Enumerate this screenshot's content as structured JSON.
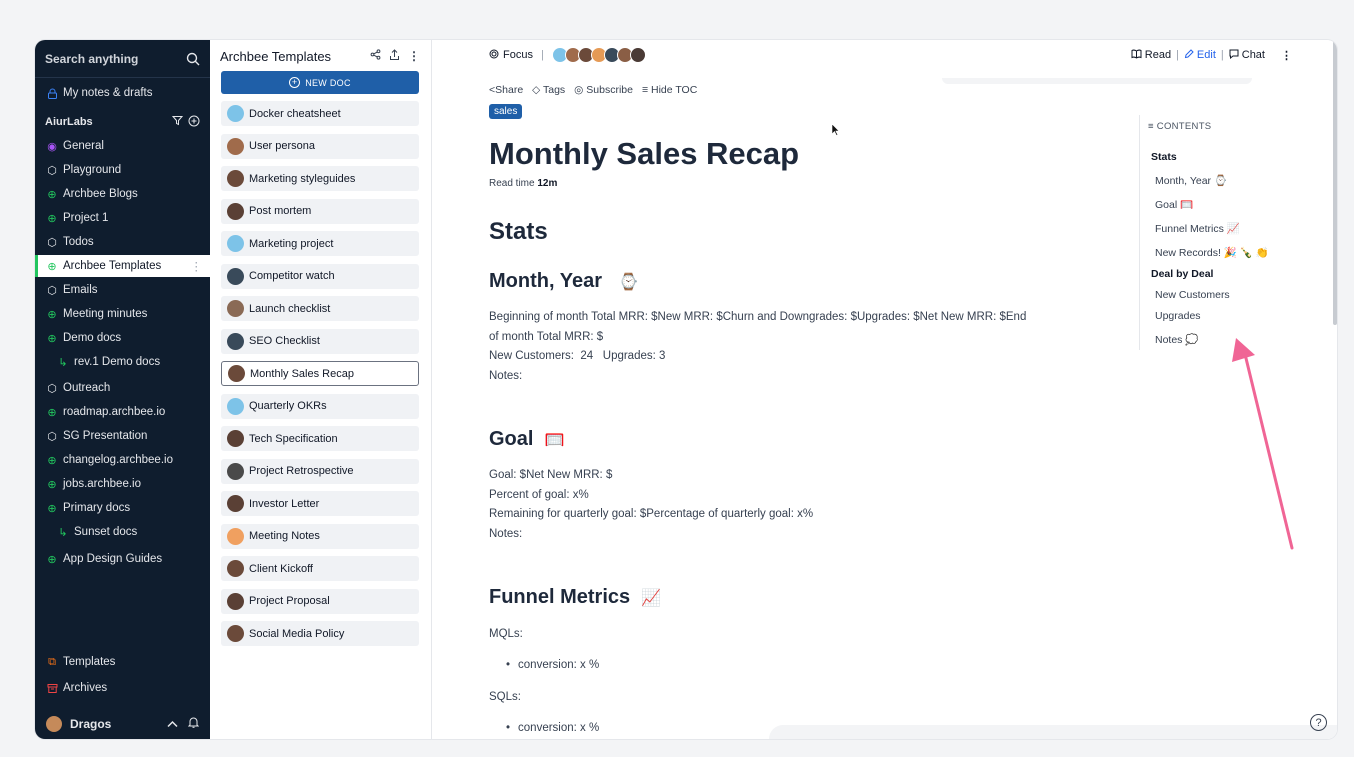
{
  "sidebar": {
    "search_placeholder": "Search anything",
    "my_notes": "My notes & drafts",
    "org_name": "AiurLabs",
    "items": [
      {
        "label": "General",
        "icon": "circle-dot-icon"
      },
      {
        "label": "Playground",
        "icon": "cube-icon"
      },
      {
        "label": "Archbee Blogs",
        "icon": "globe-icon"
      },
      {
        "label": "Project 1",
        "icon": "globe-icon"
      },
      {
        "label": "Todos",
        "icon": "cube-icon"
      },
      {
        "label": "Archbee Templates",
        "icon": "globe-icon"
      },
      {
        "label": "Emails",
        "icon": "cube-icon"
      },
      {
        "label": "Meeting minutes",
        "icon": "globe-icon"
      },
      {
        "label": "Demo docs",
        "icon": "globe-icon"
      },
      {
        "label": "rev.1 Demo docs",
        "icon": "branch-icon"
      },
      {
        "label": "Outreach",
        "icon": "cube-icon"
      },
      {
        "label": "roadmap.archbee.io",
        "icon": "globe-icon"
      },
      {
        "label": "SG Presentation",
        "icon": "cube-icon"
      },
      {
        "label": "changelog.archbee.io",
        "icon": "globe-icon"
      },
      {
        "label": "jobs.archbee.io",
        "icon": "globe-icon"
      },
      {
        "label": "Primary docs",
        "icon": "globe-icon"
      },
      {
        "label": "Sunset docs",
        "icon": "branch-icon"
      },
      {
        "label": "App Design Guides",
        "icon": "globe-icon"
      }
    ],
    "templates": "Templates",
    "archives": "Archives",
    "user_name": "Dragos"
  },
  "doclist": {
    "title": "Archbee Templates",
    "new_doc": "NEW DOC",
    "docs": [
      "Docker cheatsheet",
      "User persona",
      "Marketing styleguides",
      "Post mortem",
      "Marketing project",
      "Competitor watch",
      "Launch checklist",
      "SEO Checklist",
      "Monthly Sales Recap",
      "Quarterly OKRs",
      "Tech Specification",
      "Project Retrospective",
      "Investor Letter",
      "Meeting Notes",
      "Client Kickoff",
      "Project Proposal",
      "Social Media Policy"
    ],
    "selected": "Monthly Sales Recap"
  },
  "topbar": {
    "focus": "Focus",
    "read": "Read",
    "edit": "Edit",
    "chat": "Chat"
  },
  "actions": {
    "share": "Share",
    "tags": "Tags",
    "subscribe": "Subscribe",
    "hide_toc": "Hide TOC"
  },
  "doc": {
    "tag": "sales",
    "title": "Monthly Sales Recap",
    "read_time_label": "Read time",
    "read_time": "12m",
    "stats_heading": "Stats",
    "month_heading": "Month, Year",
    "month_emoji": "⌚",
    "month_line1": "Beginning of month Total MRR: $New MRR: $Churn and Downgrades: $Upgrades: $Net New MRR: $End",
    "month_line2": "of month Total MRR: $",
    "month_line3": "New Customers:  24   Upgrades: 3",
    "month_line4": "Notes:",
    "goal_heading": "Goal",
    "goal_emoji": "🥅",
    "goal_line1": "Goal: $Net New MRR: $",
    "goal_line2": "Percent of goal: x%",
    "goal_line3": "Remaining for quarterly goal: $Percentage of quarterly goal: x%",
    "goal_line4": "Notes:",
    "funnel_heading": "Funnel Metrics",
    "funnel_emoji": "📈",
    "mqls": "MQLs:",
    "mql_bullet": "conversion: x %",
    "sqls": "SQLs:",
    "sql_bullet": "conversion: x %"
  },
  "toc": {
    "caption": "CONTENTS",
    "entries": [
      "Stats",
      "Month, Year ⌚",
      "Goal 🥅",
      "Funnel Metrics 📈",
      "New Records! 🎉 🍾 👏",
      "Deal by Deal",
      "New Customers",
      "Upgrades",
      "Notes 💭"
    ]
  },
  "colors": {
    "sidebar_bg": "#0f1d2e",
    "accent": "#1f5fa8",
    "green": "#22c55e",
    "arrow": "#f06595"
  }
}
